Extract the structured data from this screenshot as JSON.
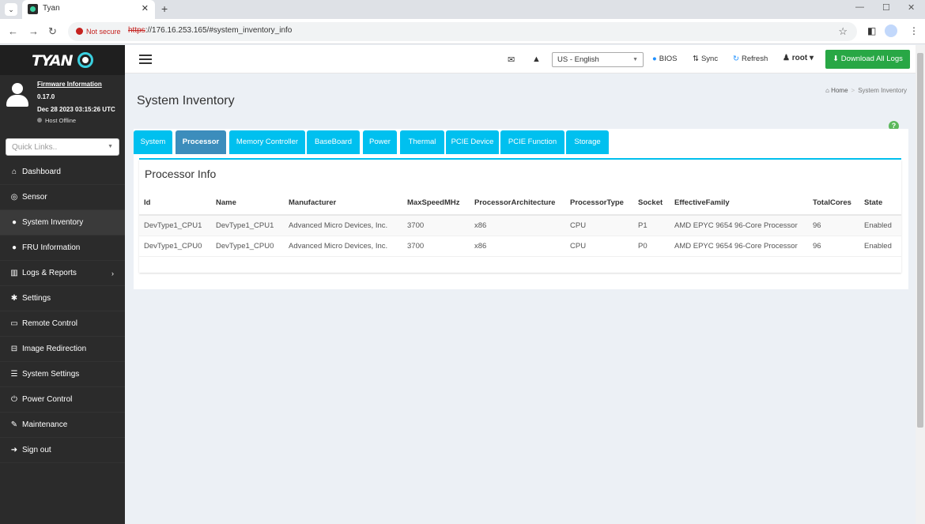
{
  "browser": {
    "tab_title": "Tyan",
    "not_secure": "Not secure",
    "url_scheme": "https",
    "url_rest": "://176.16.253.165/#system_inventory_info"
  },
  "sidebar": {
    "firmware_label": "Firmware Information",
    "firmware_version": "0.17.0",
    "firmware_date": "Dec 28 2023 03:15:26 UTC",
    "host_status": "Host Offline",
    "quick_links_placeholder": "Quick Links..",
    "items": [
      {
        "label": "Dashboard",
        "icon": "dashboard-icon"
      },
      {
        "label": "Sensor",
        "icon": "sensor-icon"
      },
      {
        "label": "System Inventory",
        "icon": "info-icon"
      },
      {
        "label": "FRU Information",
        "icon": "info-icon"
      },
      {
        "label": "Logs & Reports",
        "icon": "chart-icon"
      },
      {
        "label": "Settings",
        "icon": "gear-icon"
      },
      {
        "label": "Remote Control",
        "icon": "monitor-icon"
      },
      {
        "label": "Image Redirection",
        "icon": "drive-icon"
      },
      {
        "label": "System Settings",
        "icon": "server-icon"
      },
      {
        "label": "Power Control",
        "icon": "power-icon"
      },
      {
        "label": "Maintenance",
        "icon": "wrench-icon"
      },
      {
        "label": "Sign out",
        "icon": "sign-out-icon"
      }
    ]
  },
  "topbar": {
    "language": "US - English",
    "bios": "BIOS",
    "sync": "Sync",
    "refresh": "Refresh",
    "user": "root",
    "download": "Download All Logs"
  },
  "page": {
    "title": "System Inventory",
    "breadcrumb_home": "Home",
    "breadcrumb_current": "System Inventory"
  },
  "tabs": [
    "System",
    "Processor",
    "Memory Controller",
    "BaseBoard",
    "Power",
    "Thermal",
    "PCIE Device",
    "PCIE Function",
    "Storage"
  ],
  "active_tab": "Processor",
  "processor": {
    "box_title": "Processor Info",
    "columns": [
      "Id",
      "Name",
      "Manufacturer",
      "MaxSpeedMHz",
      "ProcessorArchitecture",
      "ProcessorType",
      "Socket",
      "EffectiveFamily",
      "TotalCores",
      "State"
    ],
    "rows": [
      [
        "DevType1_CPU1",
        "DevType1_CPU1",
        "Advanced Micro Devices, Inc.",
        "3700",
        "x86",
        "CPU",
        "P1",
        "AMD EPYC 9654 96-Core Processor",
        "96",
        "Enabled"
      ],
      [
        "DevType1_CPU0",
        "DevType1_CPU0",
        "Advanced Micro Devices, Inc.",
        "3700",
        "x86",
        "CPU",
        "P0",
        "AMD EPYC 9654 96-Core Processor",
        "96",
        "Enabled"
      ]
    ]
  },
  "colors": {
    "tab_color": "#00c0ef",
    "tab_active": "#3c8dbc",
    "download_green": "#28a745",
    "sidebar_bg": "#2b2b2b"
  }
}
